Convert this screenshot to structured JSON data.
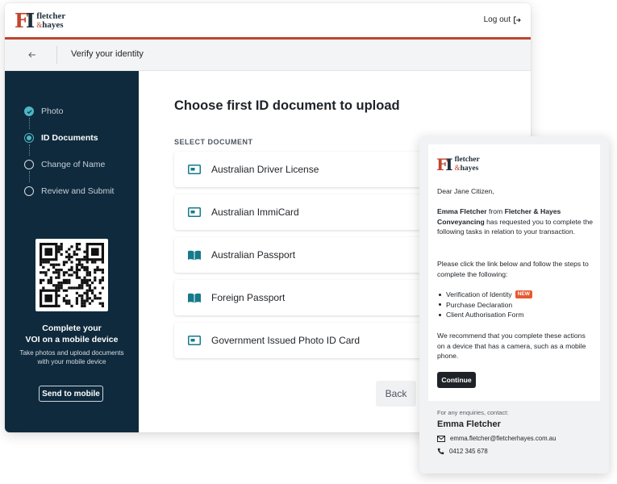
{
  "brand": {
    "line1": "fletcher",
    "amp": "&",
    "line2": "hayes",
    "accent": "#c0452f",
    "dark": "#0f2a3d"
  },
  "header": {
    "logout_label": "Log out"
  },
  "subheader": {
    "title": "Verify your identity"
  },
  "steps": [
    {
      "label": "Photo",
      "state": "done"
    },
    {
      "label": "ID Documents",
      "state": "current"
    },
    {
      "label": "Change of Name",
      "state": "todo"
    },
    {
      "label": "Review and Submit",
      "state": "todo"
    }
  ],
  "mobile": {
    "title_line1": "Complete your",
    "title_line2": "VOI on a mobile device",
    "description": "Take photos and upload documents with your mobile device",
    "button": "Send to mobile"
  },
  "main": {
    "title": "Choose first ID document to upload",
    "section_label": "SELECT DOCUMENT",
    "documents": [
      {
        "label": "Australian Driver License",
        "icon": "id-card-icon"
      },
      {
        "label": "Australian ImmiCard",
        "icon": "id-card-icon"
      },
      {
        "label": "Australian Passport",
        "icon": "passport-book-icon"
      },
      {
        "label": "Foreign Passport",
        "icon": "passport-book-icon"
      },
      {
        "label": "Government Issued Photo ID Card",
        "icon": "id-card-icon"
      }
    ],
    "back_button": "Back"
  },
  "email": {
    "greeting": "Dear Jane Citizen,",
    "sender_name": "Emma Fletcher",
    "from_word": "from",
    "company": "Fletcher & Hayes Conveyancing",
    "request_text": "has requested you to complete the following tasks in relation to your transaction.",
    "instruction": "Please click the link below and follow the steps to complete the following:",
    "tasks": [
      "Verification of Identity",
      "Purchase Declaration",
      "Client Authorisation Form"
    ],
    "new_badge": "NEW",
    "recommendation": "We recommend that you complete these actions on a device that has a camera, such as a mobile phone.",
    "continue_button": "Continue",
    "enquiries_label": "For any enquiries, contact:",
    "contact_name": "Emma Fletcher",
    "contact_email": "emma.fletcher@fletcherhayes.com.au",
    "contact_phone": "0412 345 678"
  }
}
